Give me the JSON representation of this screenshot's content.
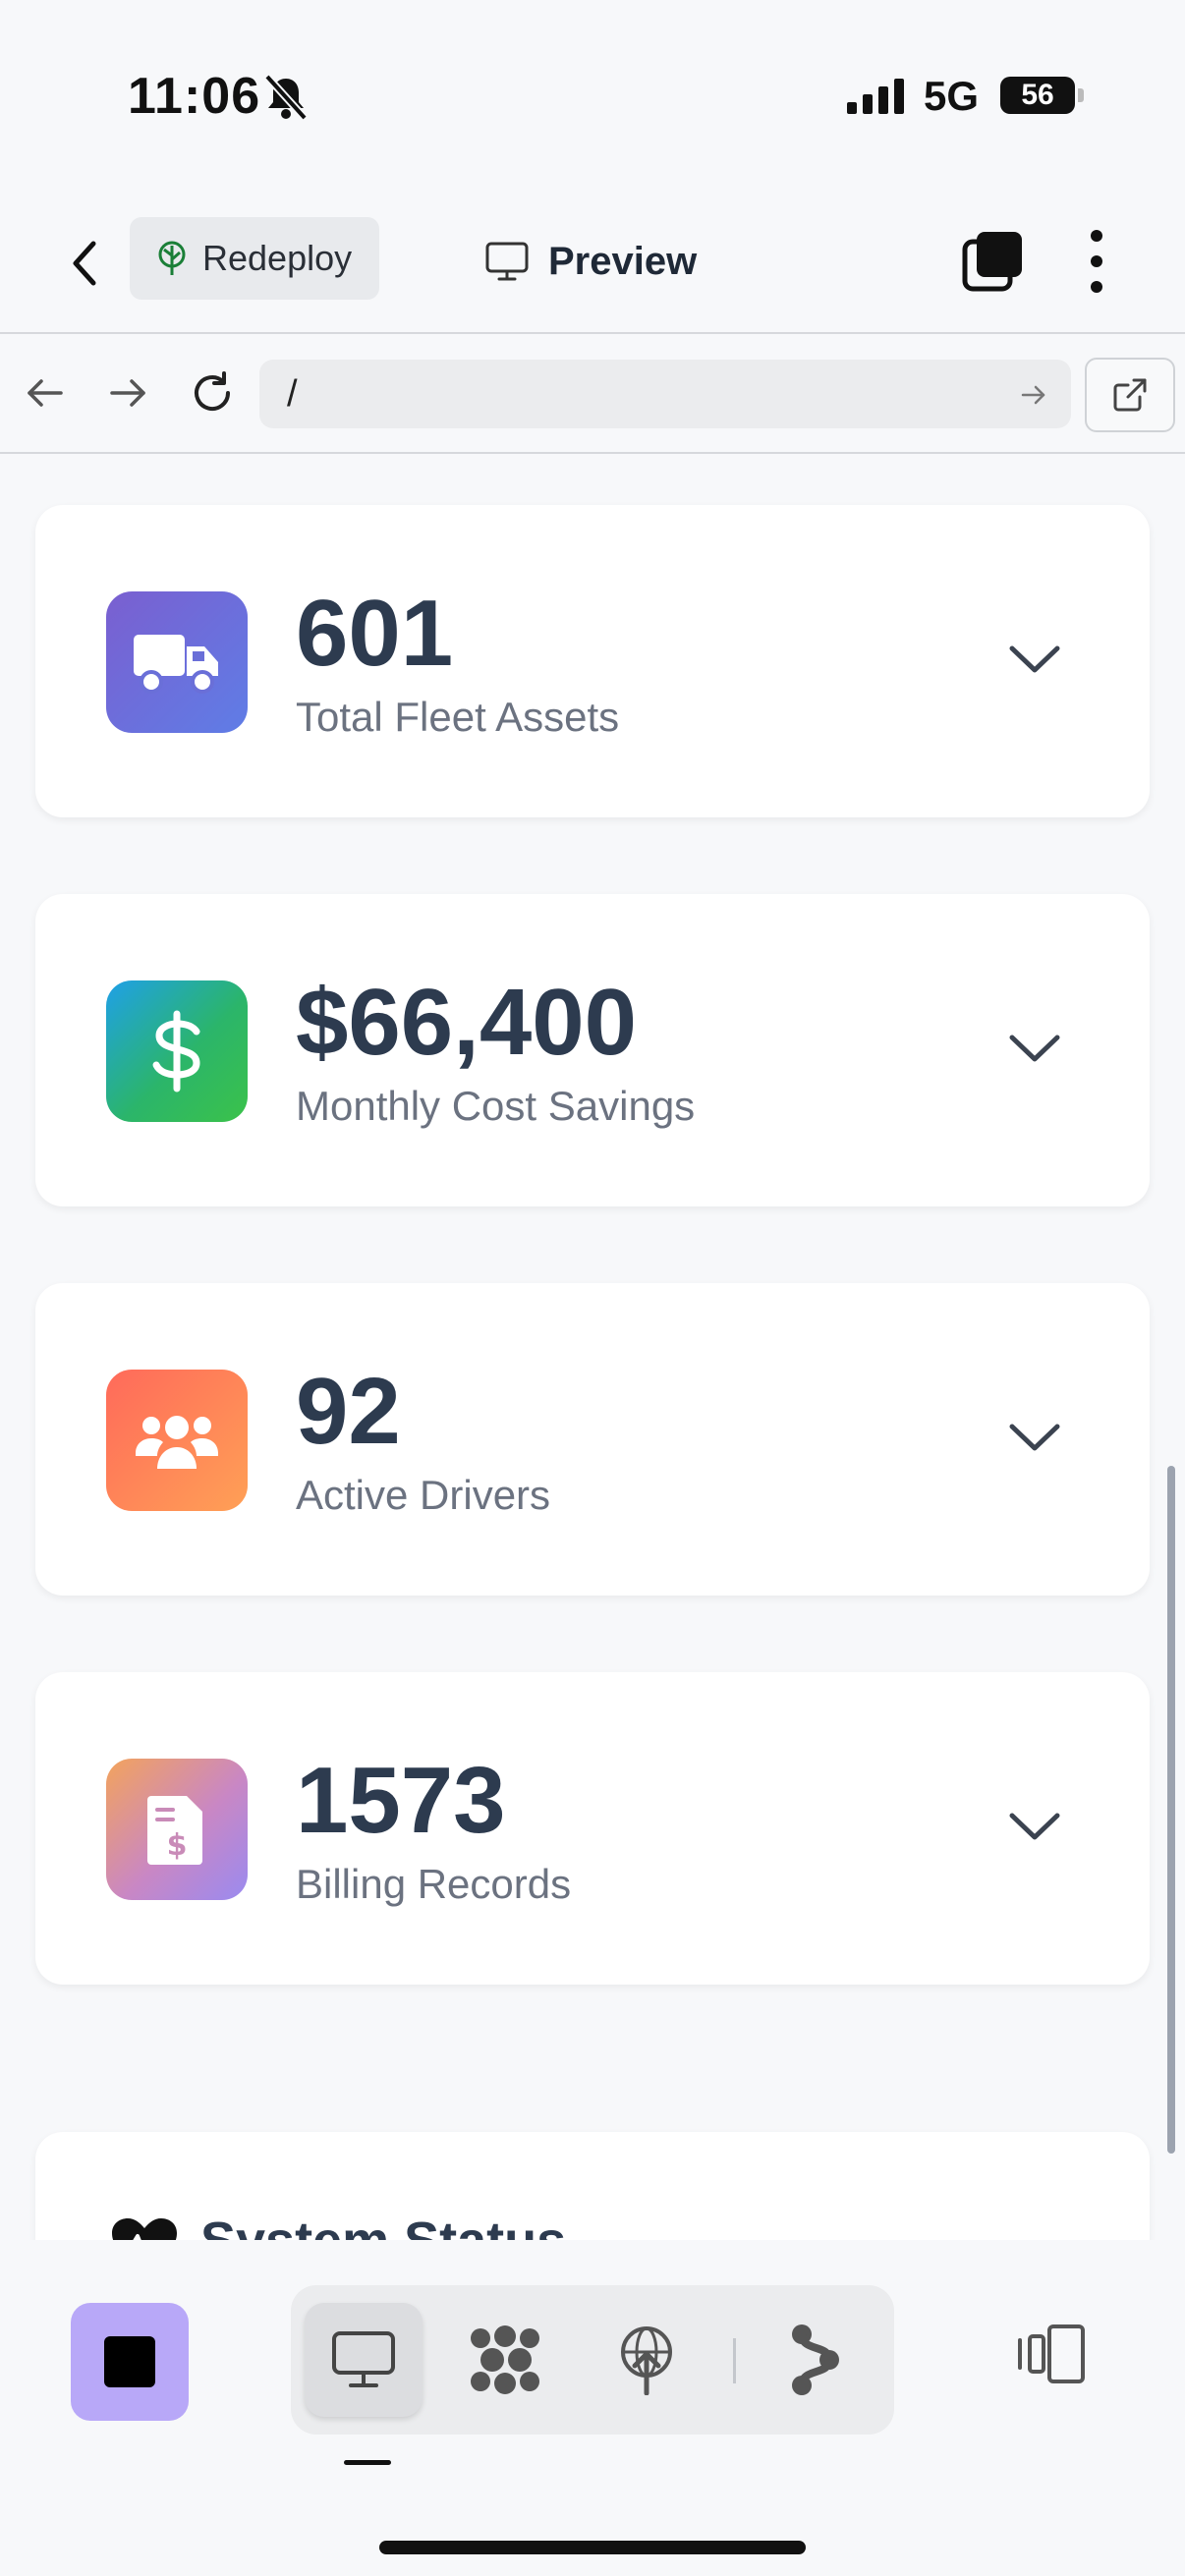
{
  "status_bar": {
    "time": "11:06",
    "network": "5G",
    "battery": "56"
  },
  "toolbar": {
    "redeploy_label": "Redeploy",
    "preview_label": "Preview"
  },
  "browser": {
    "url": "/"
  },
  "stats": [
    {
      "value": "601",
      "label": "Total Fleet Assets",
      "icon": "truck-icon"
    },
    {
      "value": "$66,400",
      "label": "Monthly Cost Savings",
      "icon": "dollar-icon"
    },
    {
      "value": "92",
      "label": "Active Drivers",
      "icon": "users-icon"
    },
    {
      "value": "1573",
      "label": "Billing Records",
      "icon": "invoice-icon"
    }
  ],
  "system_status": {
    "title": "System Status"
  },
  "colors": {
    "accent_purple": "#b8a8f8",
    "stat_text": "#2d3b4f",
    "label_text": "#6b7280"
  }
}
